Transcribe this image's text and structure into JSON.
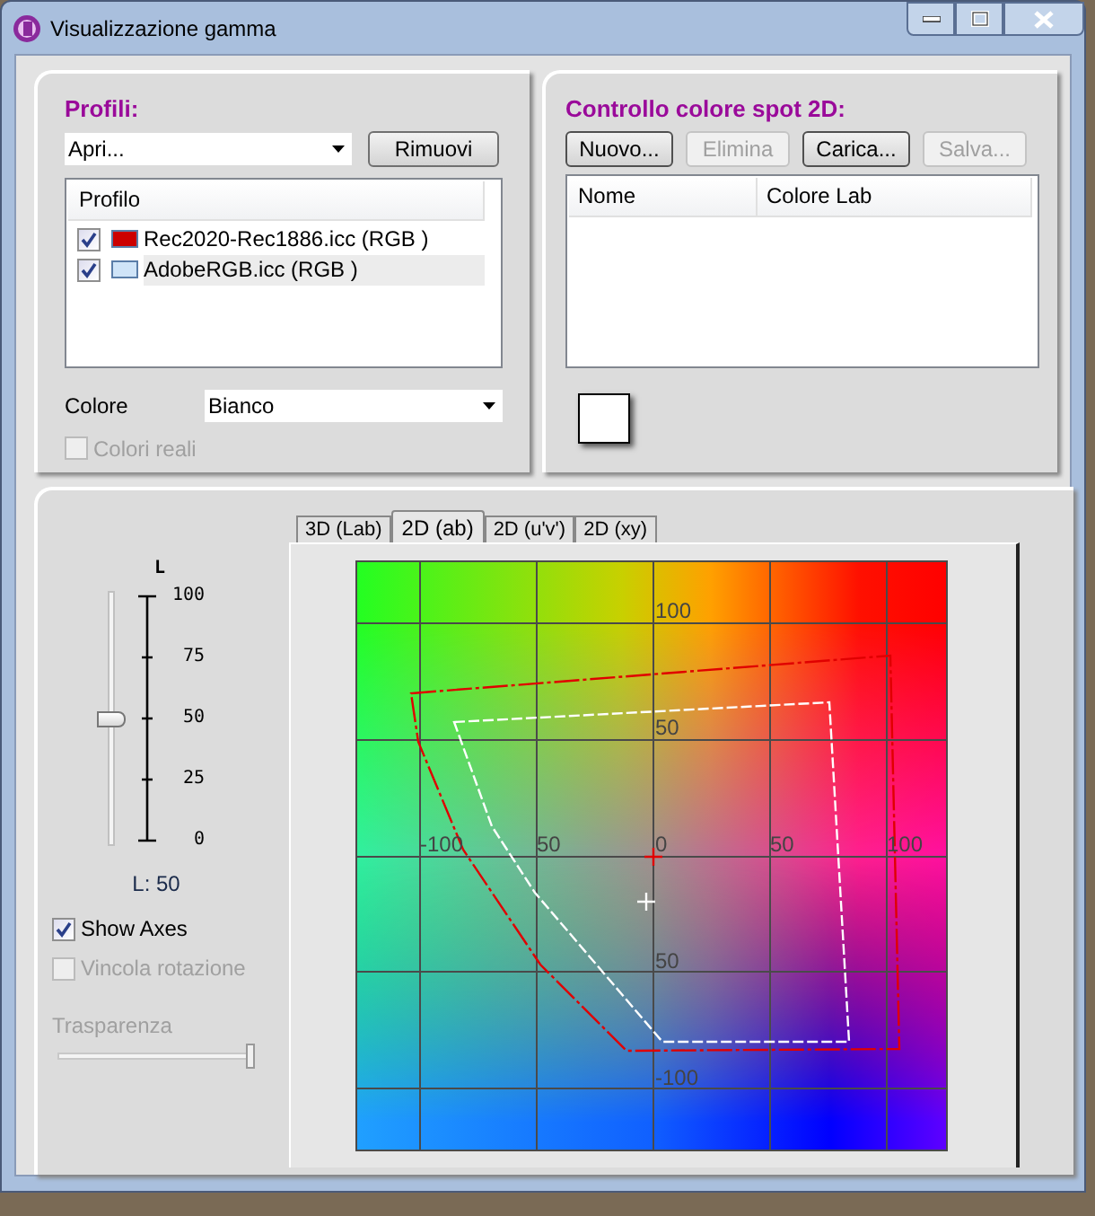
{
  "window": {
    "title": "Visualizzazione gamma"
  },
  "profiles": {
    "title": "Profili:",
    "open_dropdown": "Apri...",
    "remove_button": "Rimuovi",
    "column": "Profilo",
    "items": [
      {
        "label": "Rec2020-Rec1886.icc (RGB )",
        "checked": true,
        "selected": false,
        "color": "#cc0000"
      },
      {
        "label": "AdobeRGB.icc (RGB )",
        "checked": true,
        "selected": true,
        "color": "#cfe4f8"
      }
    ],
    "color_label": "Colore",
    "color_value": "Bianco",
    "real_colors": {
      "label": "Colori reali",
      "checked": false,
      "disabled": true
    }
  },
  "spot": {
    "title": "Controllo colore spot 2D:",
    "buttons": [
      {
        "label": "Nuovo...",
        "disabled": false
      },
      {
        "label": "Elimina",
        "disabled": true
      },
      {
        "label": "Carica...",
        "disabled": false
      },
      {
        "label": "Salva...",
        "disabled": true
      }
    ],
    "columns": [
      "Nome",
      "Colore Lab"
    ]
  },
  "lightness": {
    "title": "L",
    "ticks": [
      "100",
      "75",
      "50",
      "25",
      "0"
    ],
    "level": 0.5,
    "reading": "L: 50"
  },
  "options": [
    {
      "label": "Show Axes",
      "checked": true,
      "disabled": false
    },
    {
      "label": "Vincola rotazione",
      "checked": false,
      "disabled": true
    }
  ],
  "transparency": {
    "label": "Trasparenza",
    "level": 1,
    "disabled": true
  },
  "tabs": [
    {
      "label": "3D (Lab)",
      "selected": false
    },
    {
      "label": "2D (ab)",
      "selected": true
    },
    {
      "label": "2D (u'v')",
      "selected": false
    },
    {
      "label": "2D (xy)",
      "selected": false
    }
  ],
  "plot": {
    "labels": [
      "100",
      "50",
      "-100",
      "50",
      "0",
      "50",
      "100",
      "50",
      "-100"
    ]
  }
}
